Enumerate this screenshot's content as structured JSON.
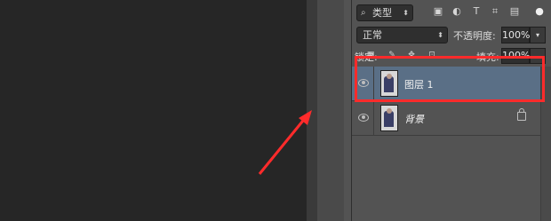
{
  "filter": {
    "kind_label": "类型",
    "icons": [
      "image-filter-icon",
      "adjustment-filter-icon",
      "text-filter-icon",
      "shape-filter-icon",
      "smart-object-filter-icon"
    ]
  },
  "blend": {
    "mode": "正常",
    "opacity_label": "不透明度:",
    "opacity_value": "100%"
  },
  "lock": {
    "label": "锁定:",
    "fill_label": "填充:",
    "fill_value": "100%"
  },
  "layers": [
    {
      "name": "图层 1",
      "selected": true,
      "visible": true
    },
    {
      "name": "背景",
      "selected": false,
      "visible": true,
      "locked": true
    }
  ],
  "colors": {
    "highlight": "#ff2b2b",
    "selected_row": "#5a6f86",
    "panel": "#535353",
    "canvas": "#262626"
  }
}
